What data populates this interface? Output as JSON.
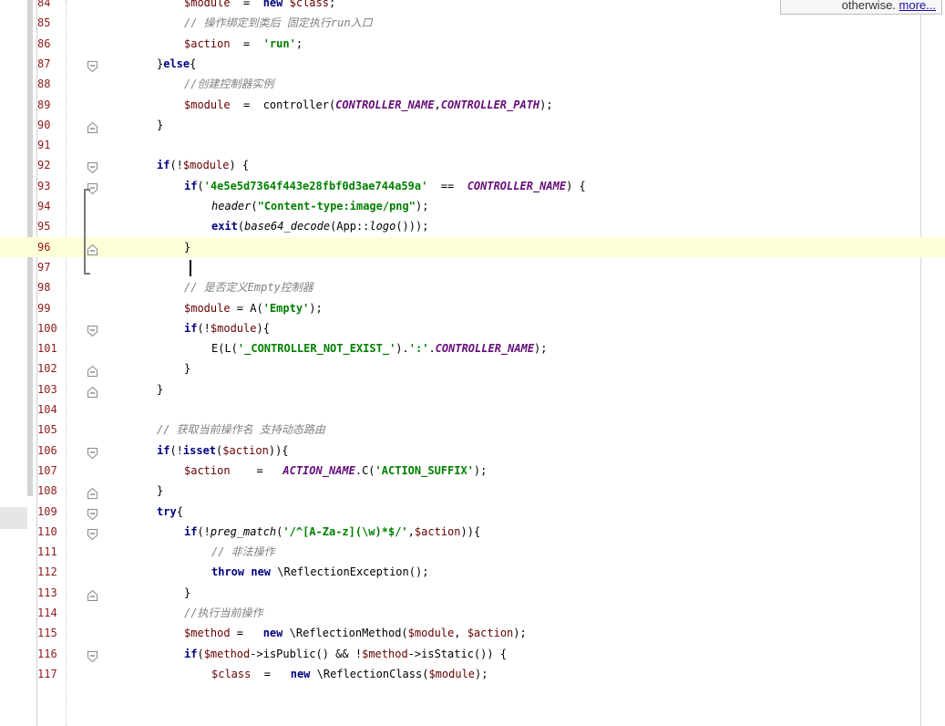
{
  "popup": {
    "text": "otherwise. ",
    "link": "more..."
  },
  "current_line": 96,
  "lines": [
    {
      "n": 84,
      "fold": "",
      "indent": 1,
      "tokens": [
        [
          "var",
          "$module"
        ],
        [
          "",
          "  =  "
        ],
        [
          "kw",
          "new"
        ],
        [
          "var",
          " $class"
        ],
        [
          "",
          ";"
        ]
      ]
    },
    {
      "n": 85,
      "fold": "",
      "indent": 1,
      "tokens": [
        [
          "cm",
          "// 操作绑定到类后 固定执行run入口"
        ]
      ]
    },
    {
      "n": 86,
      "fold": "",
      "indent": 1,
      "tokens": [
        [
          "var",
          "$action"
        ],
        [
          "",
          "  =  "
        ],
        [
          "str",
          "'run'"
        ],
        [
          "",
          ";"
        ]
      ]
    },
    {
      "n": 87,
      "fold": "open",
      "indent": 0,
      "tokens": [
        [
          "",
          "}"
        ],
        [
          "kw",
          "else"
        ],
        [
          "",
          "{"
        ]
      ]
    },
    {
      "n": 88,
      "fold": "",
      "indent": 1,
      "tokens": [
        [
          "cm",
          "//创建控制器实例"
        ]
      ]
    },
    {
      "n": 89,
      "fold": "",
      "indent": 1,
      "tokens": [
        [
          "var",
          "$module"
        ],
        [
          "",
          "  =  controller("
        ],
        [
          "const",
          "CONTROLLER_NAME"
        ],
        [
          "",
          ","
        ],
        [
          "const",
          "CONTROLLER_PATH"
        ],
        [
          "",
          ");"
        ]
      ]
    },
    {
      "n": 90,
      "fold": "close",
      "indent": 0,
      "tokens": [
        [
          "",
          "}"
        ]
      ]
    },
    {
      "n": 91,
      "fold": "",
      "indent": 0,
      "tokens": []
    },
    {
      "n": 92,
      "fold": "open",
      "indent": 0,
      "tokens": [
        [
          "kw",
          "if"
        ],
        [
          "",
          "(!"
        ],
        [
          "var",
          "$module"
        ],
        [
          "",
          ") {"
        ]
      ]
    },
    {
      "n": 93,
      "fold": "open",
      "indent": 1,
      "tokens": [
        [
          "kw",
          "if"
        ],
        [
          "",
          "("
        ],
        [
          "str",
          "'4e5e5d7364f443e28fbf0d3ae744a59a'"
        ],
        [
          "",
          "  ==  "
        ],
        [
          "const",
          "CONTROLLER_NAME"
        ],
        [
          "",
          ") {"
        ]
      ]
    },
    {
      "n": 94,
      "fold": "",
      "indent": 2,
      "tokens": [
        [
          "fn",
          "header"
        ],
        [
          "",
          "("
        ],
        [
          "str",
          "\"Content-type:image/png\""
        ],
        [
          "",
          ");"
        ]
      ]
    },
    {
      "n": 95,
      "fold": "",
      "indent": 2,
      "tokens": [
        [
          "kw",
          "exit"
        ],
        [
          "",
          "("
        ],
        [
          "fn",
          "base64_decode"
        ],
        [
          "",
          "(App::"
        ],
        [
          "fn",
          "logo"
        ],
        [
          "",
          "()));"
        ]
      ]
    },
    {
      "n": 96,
      "fold": "close",
      "indent": 1,
      "tokens": [
        [
          "",
          "}"
        ]
      ]
    },
    {
      "n": 97,
      "fold": "",
      "indent": 0,
      "tokens": []
    },
    {
      "n": 98,
      "fold": "",
      "indent": 1,
      "tokens": [
        [
          "cm",
          "// 是否定义Empty控制器"
        ]
      ]
    },
    {
      "n": 99,
      "fold": "",
      "indent": 1,
      "tokens": [
        [
          "var",
          "$module"
        ],
        [
          "",
          " = A("
        ],
        [
          "str",
          "'Empty'"
        ],
        [
          "",
          ");"
        ]
      ]
    },
    {
      "n": 100,
      "fold": "open",
      "indent": 1,
      "tokens": [
        [
          "kw",
          "if"
        ],
        [
          "",
          "(!"
        ],
        [
          "var",
          "$module"
        ],
        [
          "",
          "){"
        ]
      ]
    },
    {
      "n": 101,
      "fold": "",
      "indent": 2,
      "tokens": [
        [
          "",
          "E(L("
        ],
        [
          "str",
          "'_CONTROLLER_NOT_EXIST_'"
        ],
        [
          "",
          ")."
        ],
        [
          "str",
          "':'"
        ],
        [
          "",
          "."
        ],
        [
          "const",
          "CONTROLLER_NAME"
        ],
        [
          "",
          ");"
        ]
      ]
    },
    {
      "n": 102,
      "fold": "close",
      "indent": 1,
      "tokens": [
        [
          "",
          "}"
        ]
      ]
    },
    {
      "n": 103,
      "fold": "close",
      "indent": 0,
      "tokens": [
        [
          "",
          "}"
        ]
      ]
    },
    {
      "n": 104,
      "fold": "",
      "indent": 0,
      "tokens": []
    },
    {
      "n": 105,
      "fold": "",
      "indent": 0,
      "tokens": [
        [
          "cm",
          "// 获取当前操作名 支持动态路由"
        ]
      ]
    },
    {
      "n": 106,
      "fold": "open",
      "indent": 0,
      "tokens": [
        [
          "kw",
          "if"
        ],
        [
          "",
          "(!"
        ],
        [
          "kw",
          "isset"
        ],
        [
          "",
          "("
        ],
        [
          "var",
          "$action"
        ],
        [
          "",
          "))"
        ],
        [
          "",
          "{"
        ]
      ]
    },
    {
      "n": 107,
      "fold": "",
      "indent": 1,
      "tokens": [
        [
          "var",
          "$action"
        ],
        [
          "",
          "    =   "
        ],
        [
          "const",
          "ACTION_NAME"
        ],
        [
          "",
          ".C("
        ],
        [
          "str",
          "'ACTION_SUFFIX'"
        ],
        [
          "",
          ");"
        ]
      ]
    },
    {
      "n": 108,
      "fold": "close",
      "indent": 0,
      "tokens": [
        [
          "",
          "}"
        ]
      ]
    },
    {
      "n": 109,
      "fold": "open",
      "indent": 0,
      "tokens": [
        [
          "kw",
          "try"
        ],
        [
          "",
          "{"
        ]
      ]
    },
    {
      "n": 110,
      "fold": "open",
      "indent": 1,
      "tokens": [
        [
          "kw",
          "if"
        ],
        [
          "",
          "(!"
        ],
        [
          "fn",
          "preg_match"
        ],
        [
          "",
          "("
        ],
        [
          "str",
          "'/^[A-Za-z](\\w)*$/'"
        ],
        [
          "",
          ","
        ],
        [
          "var",
          "$action"
        ],
        [
          "",
          "))"
        ],
        [
          "",
          "{"
        ]
      ]
    },
    {
      "n": 111,
      "fold": "",
      "indent": 2,
      "tokens": [
        [
          "cm",
          "// 非法操作"
        ]
      ]
    },
    {
      "n": 112,
      "fold": "",
      "indent": 2,
      "tokens": [
        [
          "kw",
          "throw new"
        ],
        [
          "",
          " \\ReflectionException();"
        ]
      ]
    },
    {
      "n": 113,
      "fold": "close",
      "indent": 1,
      "tokens": [
        [
          "",
          "}"
        ]
      ]
    },
    {
      "n": 114,
      "fold": "",
      "indent": 1,
      "tokens": [
        [
          "cm",
          "//执行当前操作"
        ]
      ]
    },
    {
      "n": 115,
      "fold": "",
      "indent": 1,
      "tokens": [
        [
          "var",
          "$method"
        ],
        [
          "",
          " =   "
        ],
        [
          "kw",
          "new"
        ],
        [
          "",
          " \\ReflectionMethod("
        ],
        [
          "var",
          "$module"
        ],
        [
          "",
          ", "
        ],
        [
          "var",
          "$action"
        ],
        [
          "",
          ");"
        ]
      ]
    },
    {
      "n": 116,
      "fold": "open",
      "indent": 1,
      "tokens": [
        [
          "kw",
          "if"
        ],
        [
          "",
          "("
        ],
        [
          "var",
          "$method"
        ],
        [
          "",
          "->isPublic() && !"
        ],
        [
          "var",
          "$method"
        ],
        [
          "",
          "->isStatic()) {"
        ]
      ]
    },
    {
      "n": 117,
      "fold": "",
      "indent": 2,
      "tokens": [
        [
          "var",
          "$class"
        ],
        [
          "",
          "  =   "
        ],
        [
          "kw",
          "new"
        ],
        [
          "",
          " \\ReflectionClass("
        ],
        [
          "var",
          "$module"
        ],
        [
          "",
          ");"
        ]
      ]
    }
  ]
}
